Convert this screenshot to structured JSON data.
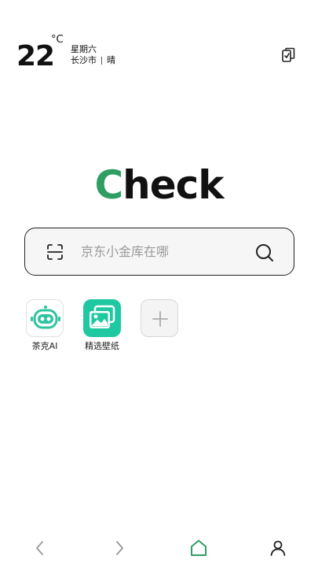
{
  "weather": {
    "temperature": "22",
    "unit": "°C",
    "weekday": "星期六",
    "city": "长沙市",
    "condition": "晴"
  },
  "logo": {
    "first_letter": "C",
    "rest": "heck",
    "accent_color": "#2f9e63"
  },
  "search": {
    "placeholder": "京东小金库在哪",
    "scan_icon": "scan-icon",
    "search_icon": "search-icon"
  },
  "apps": [
    {
      "label": "茶克AI",
      "icon": "robot-icon"
    },
    {
      "label": "精选壁纸",
      "icon": "wallpaper-icon"
    },
    {
      "label": "",
      "icon": "plus-icon"
    }
  ],
  "bottom_nav": {
    "items": [
      "back-icon",
      "forward-icon",
      "home-icon",
      "profile-icon"
    ],
    "active": "home-icon",
    "active_color": "#2f9e63"
  }
}
